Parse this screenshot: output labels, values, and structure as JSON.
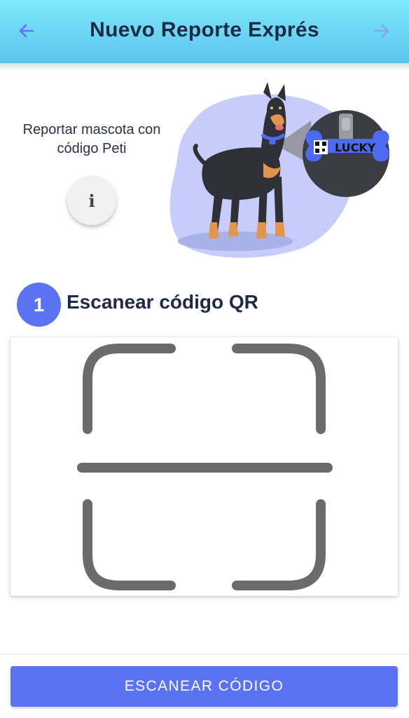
{
  "header": {
    "title": "Nuevo Reporte Exprés",
    "back_icon": "arrow-left-icon",
    "forward_icon": "arrow-right-icon"
  },
  "intro": {
    "text": "Reportar mascota con código Peti",
    "info_glyph": "i",
    "info_icon": "info-icon"
  },
  "illustration": {
    "tag_text": "LUCKY"
  },
  "step": {
    "number": "1",
    "title": "Escanear código QR"
  },
  "actions": {
    "scan_button": "ESCANEAR CÓDIGO"
  },
  "colors": {
    "header_top": "#7de9fb",
    "header_bottom": "#5cc3ee",
    "accent": "#5c72f5",
    "title_text": "#1f2a44",
    "frame": "#6b6b6b"
  }
}
